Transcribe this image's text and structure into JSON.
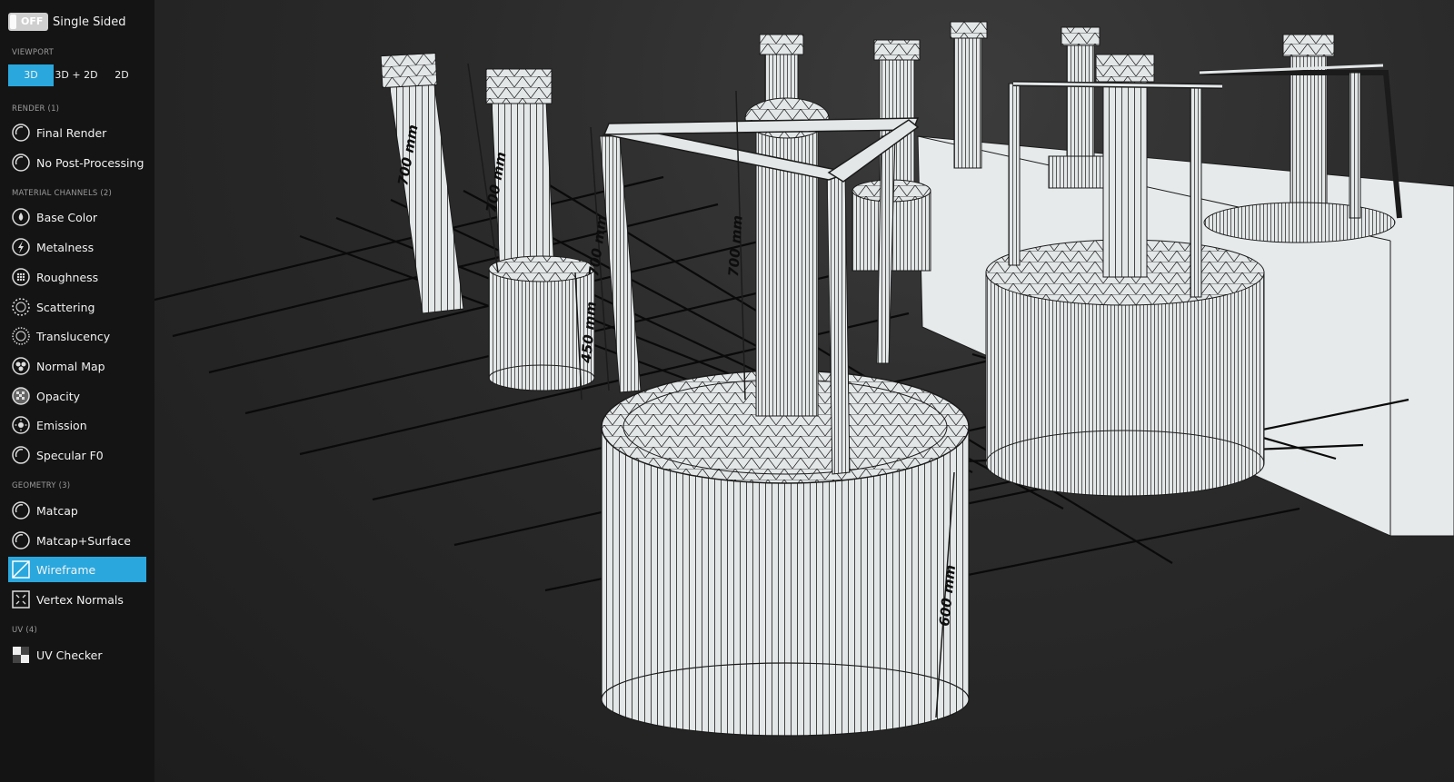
{
  "toggle": {
    "state": "OFF",
    "label": "Single Sided"
  },
  "viewport_section": {
    "title": "VIEWPORT",
    "buttons": [
      {
        "label": "3D",
        "active": true
      },
      {
        "label": "3D + 2D",
        "active": false
      },
      {
        "label": "2D",
        "active": false
      }
    ]
  },
  "render": {
    "title": "RENDER (1)",
    "items": [
      {
        "label": "Final Render",
        "icon": "final-render-icon"
      },
      {
        "label": "No Post-Processing",
        "icon": "no-post-processing-icon"
      }
    ]
  },
  "material": {
    "title": "MATERIAL CHANNELS (2)",
    "items": [
      {
        "label": "Base Color",
        "icon": "base-color-icon"
      },
      {
        "label": "Metalness",
        "icon": "metalness-icon"
      },
      {
        "label": "Roughness",
        "icon": "roughness-icon"
      },
      {
        "label": "Scattering",
        "icon": "scattering-icon"
      },
      {
        "label": "Translucency",
        "icon": "translucency-icon"
      },
      {
        "label": "Normal Map",
        "icon": "normal-map-icon"
      },
      {
        "label": "Opacity",
        "icon": "opacity-icon"
      },
      {
        "label": "Emission",
        "icon": "emission-icon"
      },
      {
        "label": "Specular F0",
        "icon": "specular-f0-icon"
      }
    ]
  },
  "geometry": {
    "title": "GEOMETRY (3)",
    "items": [
      {
        "label": "Matcap",
        "icon": "matcap-icon"
      },
      {
        "label": "Matcap+Surface",
        "icon": "matcap-surface-icon"
      },
      {
        "label": "Wireframe",
        "icon": "wireframe-icon",
        "active": true
      },
      {
        "label": "Vertex Normals",
        "icon": "vertex-normals-icon"
      }
    ]
  },
  "uv": {
    "title": "UV (4)",
    "items": [
      {
        "label": "UV Checker",
        "icon": "uv-checker-icon"
      }
    ]
  },
  "dimensions": [
    "700 mm",
    "700 mm",
    "700 mm",
    "700 mm",
    "450 mm",
    "600 mm"
  ],
  "colors": {
    "accent": "#2aa7dd",
    "sidebar": "#141414",
    "model": "#e3e7e8"
  }
}
